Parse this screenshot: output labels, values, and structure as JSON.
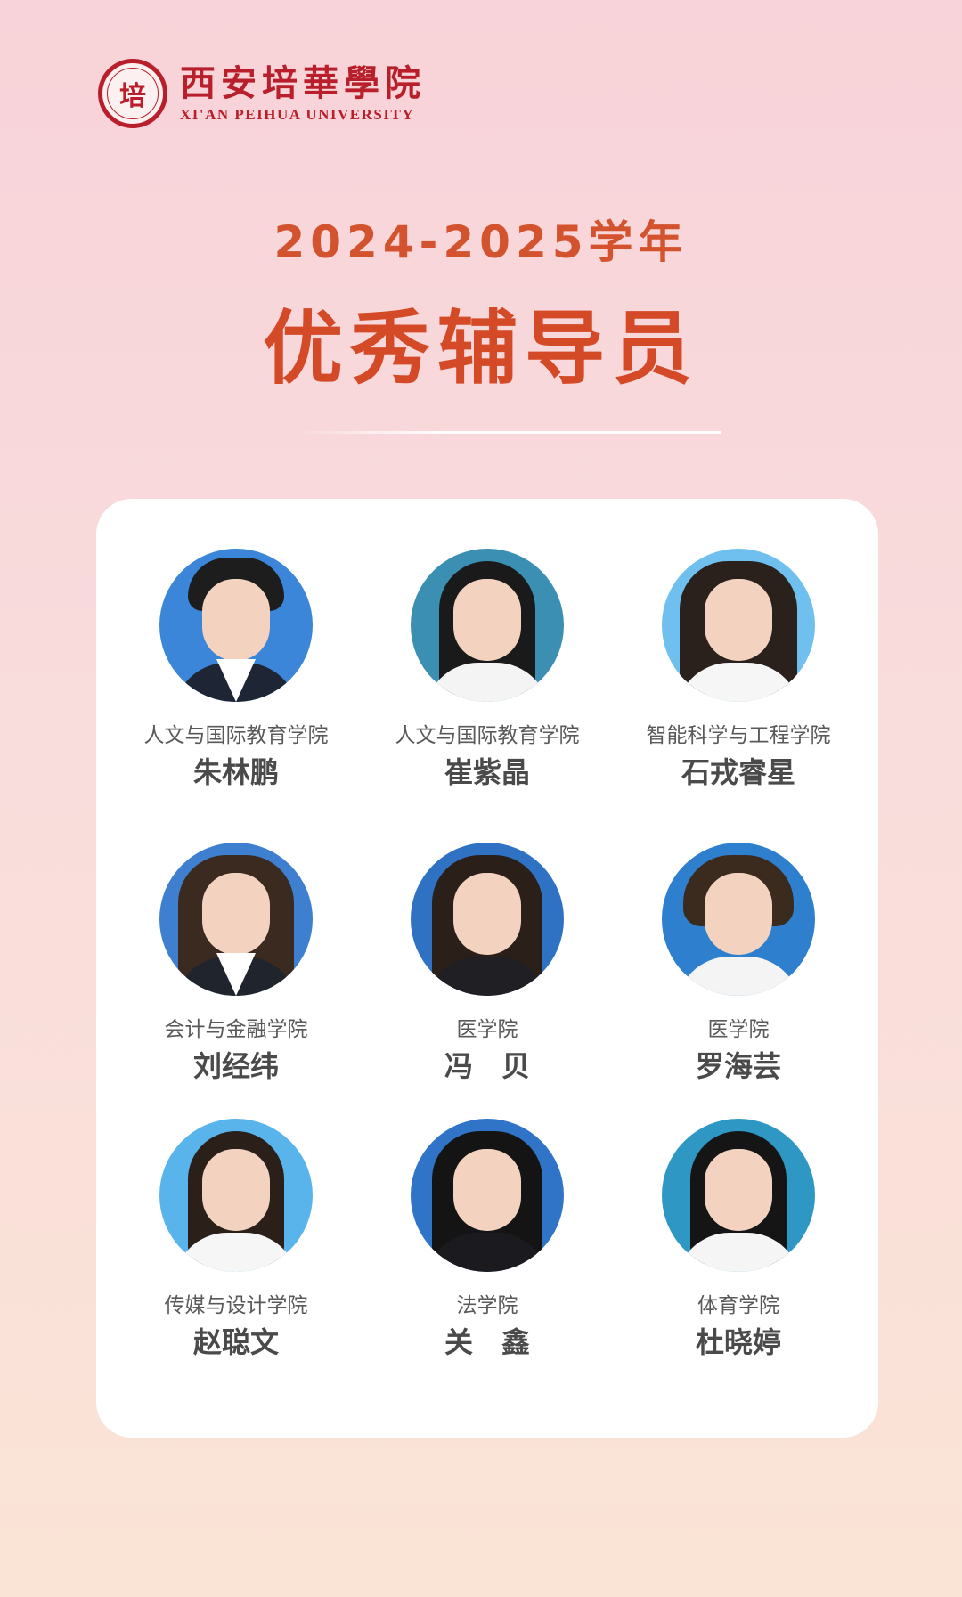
{
  "header": {
    "seal_glyph": "培",
    "name_cn": "西安培華學院",
    "name_en": "XI'AN PEIHUA UNIVERSITY"
  },
  "banner": {
    "year": "2024-2025学年",
    "title": "优秀辅导员"
  },
  "colors": {
    "brand_red": "#b81f2a",
    "title_orange": "#d44a27"
  },
  "people": [
    {
      "dept": "人文与国际教育学院",
      "name": "朱林鹏"
    },
    {
      "dept": "人文与国际教育学院",
      "name": "崔紫晶"
    },
    {
      "dept": "智能科学与工程学院",
      "name": "石戎睿星"
    },
    {
      "dept": "会计与金融学院",
      "name": "刘经纬"
    },
    {
      "dept": "医学院",
      "name": "冯　贝"
    },
    {
      "dept": "医学院",
      "name": "罗海芸"
    },
    {
      "dept": "传媒与设计学院",
      "name": "赵聪文"
    },
    {
      "dept": "法学院",
      "name": "关　鑫"
    },
    {
      "dept": "体育学院",
      "name": "杜晓婷"
    }
  ]
}
